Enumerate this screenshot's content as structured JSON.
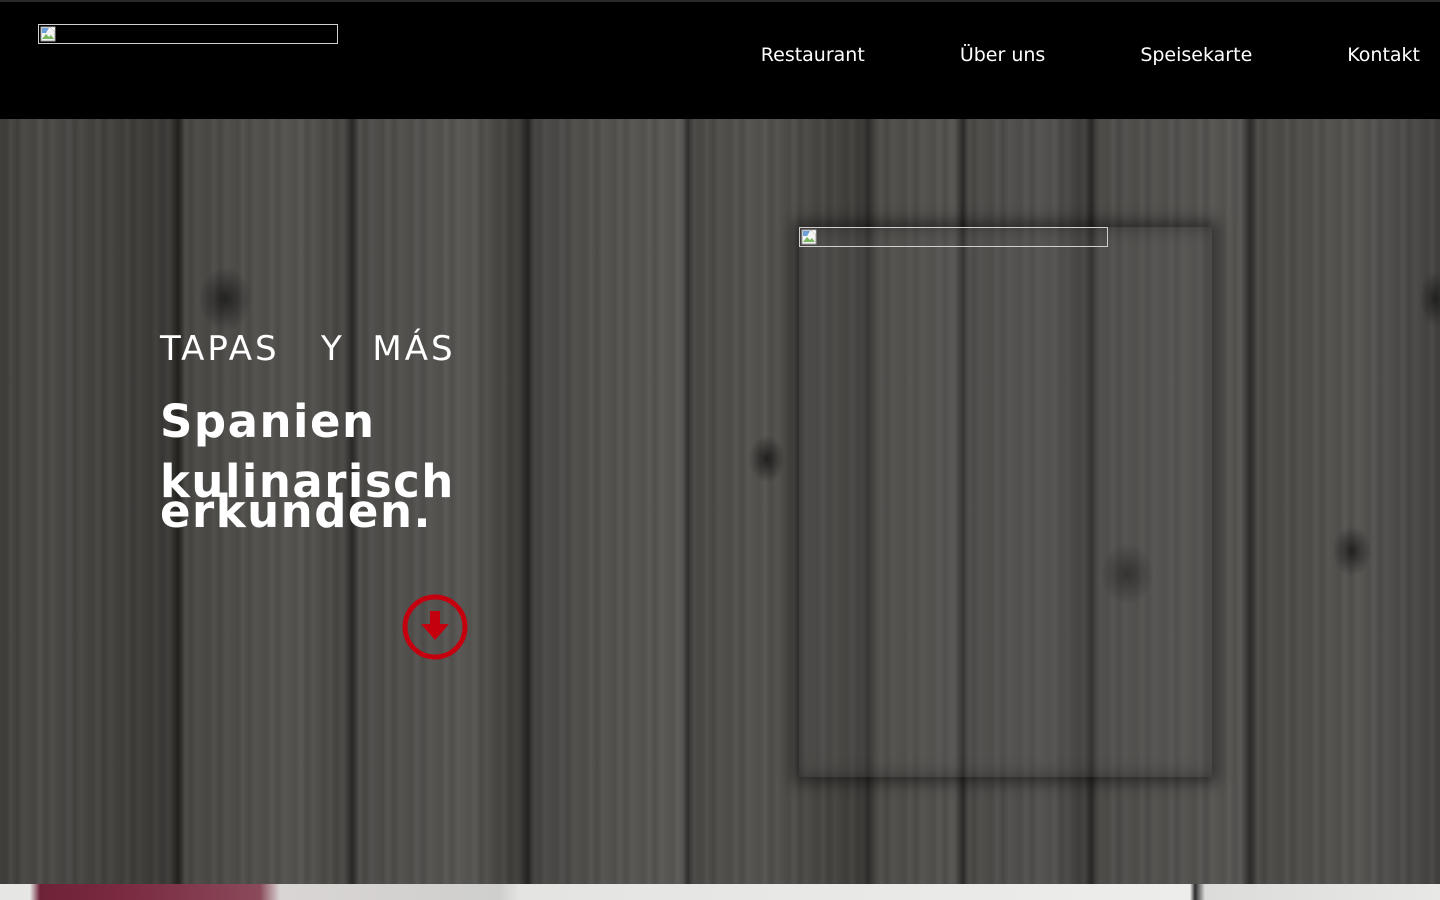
{
  "header": {
    "logo_icon": "broken-image-icon",
    "nav": [
      {
        "label": "Restaurant"
      },
      {
        "label": "Über uns"
      },
      {
        "label": "Speisekarte"
      },
      {
        "label": "Kontakt"
      }
    ]
  },
  "hero": {
    "eyebrow": "TAPAS   Y  MÁS",
    "headline_line1": "Spanien",
    "headline_line2": "kulinarisch",
    "headline_line3": "erkunden.",
    "scroll_icon": "arrow-down-circle-icon",
    "accent_color": "#c4000f",
    "photo_icon": "broken-image-icon"
  }
}
